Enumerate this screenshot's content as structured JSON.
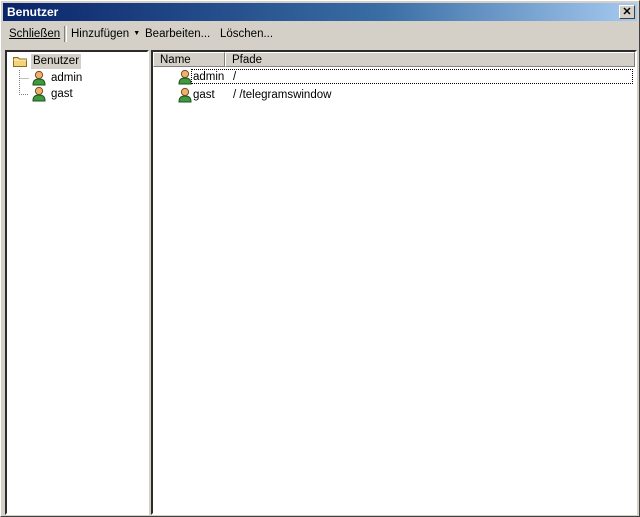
{
  "window": {
    "title": "Benutzer",
    "close_glyph": "✕"
  },
  "toolbar": {
    "close_label": "Schließen",
    "add_label": "Hinzufügen",
    "edit_label": "Bearbeiten...",
    "delete_label": "Löschen..."
  },
  "tree": {
    "root_label": "Benutzer",
    "items": [
      {
        "label": "admin"
      },
      {
        "label": "gast"
      }
    ]
  },
  "list": {
    "columns": [
      "Name",
      "Pfade"
    ],
    "rows": [
      {
        "name": "admin",
        "paths": "/"
      },
      {
        "name": "gast",
        "paths": "/ /telegramswindow"
      }
    ]
  },
  "icons": {
    "folder": "folder-icon",
    "user": "user-icon"
  },
  "colors": {
    "title_bar": "#0a246a",
    "face": "#d4d0c8",
    "folder": "#f4d27a"
  }
}
